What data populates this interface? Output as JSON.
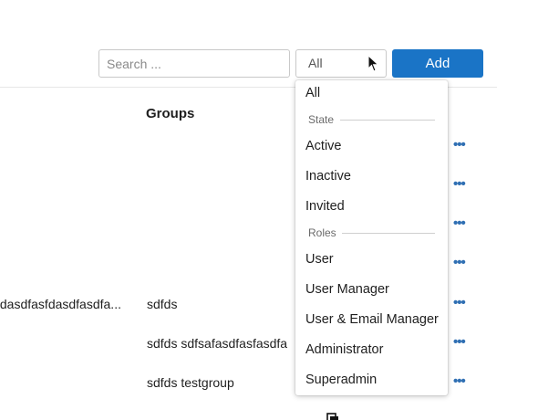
{
  "toolbar": {
    "search_placeholder": "Search ...",
    "filter_value": "All",
    "add_label": "Add"
  },
  "table": {
    "columns": {
      "groups": "Groups"
    },
    "rows": [
      {
        "name": "",
        "groups": ""
      },
      {
        "name": "",
        "groups": ""
      },
      {
        "name": "",
        "groups": ""
      },
      {
        "name": "",
        "groups": ""
      },
      {
        "name": "fdasdfasfdasdfasdfa...",
        "groups": "sdfds"
      },
      {
        "name": "",
        "groups": "sdfds sdfsafasdfasfasdfa"
      },
      {
        "name": "",
        "groups": "sdfds testgroup"
      }
    ],
    "row_actions_glyph": "•••"
  },
  "dropdown": {
    "all": "All",
    "state_label": "State",
    "state_options": [
      "Active",
      "Inactive",
      "Invited"
    ],
    "roles_label": "Roles",
    "role_options": [
      "User",
      "User Manager",
      "User & Email Manager",
      "Administrator",
      "Superadmin"
    ]
  },
  "colors": {
    "accent": "#1a74c6",
    "row_action": "#2f6fb3"
  }
}
